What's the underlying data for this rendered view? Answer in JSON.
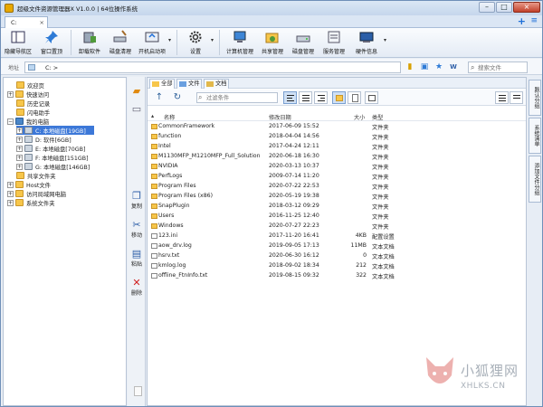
{
  "window": {
    "title": "超级文件资源管理器X V1.0.0 | 64位操作系统",
    "active_tab": "C:",
    "tab_close": "×",
    "min": "–",
    "max": "□",
    "close": "×"
  },
  "toolbar": {
    "items": [
      {
        "label": "隐藏导航区",
        "icon": "sidebar-icon"
      },
      {
        "label": "窗口置顶",
        "icon": "pin-icon"
      },
      {
        "label": "卸载软件",
        "icon": "uninstall-icon"
      },
      {
        "label": "磁盘清理",
        "icon": "disk-clean-icon"
      },
      {
        "label": "开机启动项",
        "icon": "startup-icon"
      },
      {
        "label": "设置",
        "icon": "gear-icon"
      },
      {
        "label": "计算机管理",
        "icon": "computer-icon"
      },
      {
        "label": "共享管理",
        "icon": "share-icon"
      },
      {
        "label": "磁盘管理",
        "icon": "disk-icon"
      },
      {
        "label": "服务管理",
        "icon": "services-icon"
      },
      {
        "label": "硬件信息",
        "icon": "hardware-icon"
      }
    ]
  },
  "address": {
    "label": "地址",
    "path": "C: >",
    "search_placeholder": "搜索文件"
  },
  "tree": {
    "items": [
      {
        "label": "欢迎页"
      },
      {
        "label": "快速访问"
      },
      {
        "label": "历史记录"
      },
      {
        "label": "闪电助手"
      },
      {
        "label": "我的电脑"
      },
      {
        "label": "C: 本地磁盘[19GB]"
      },
      {
        "label": "D: 软件[6GB]"
      },
      {
        "label": "E: 本地磁盘[70GB]"
      },
      {
        "label": "F: 本地磁盘[151GB]"
      },
      {
        "label": "G: 本地磁盘[146GB]"
      },
      {
        "label": "共享文件夹"
      },
      {
        "label": "Host文件"
      },
      {
        "label": "访问局域网电脑"
      },
      {
        "label": "系统文件夹"
      }
    ]
  },
  "side_actions": {
    "copy": "复制",
    "move": "移动",
    "paste": "粘贴",
    "delete": "删除"
  },
  "file_tabs": [
    "全部",
    "文件",
    "文档"
  ],
  "filter_placeholder": "过滤条件",
  "columns": {
    "name": "名称",
    "modified": "修改日期",
    "size": "大小",
    "type": "类型"
  },
  "files": [
    {
      "name": "CommonFramework",
      "modified": "2017-06-09 15:52",
      "size": "",
      "type": "文件夹",
      "kind": "folder"
    },
    {
      "name": "function",
      "modified": "2018-04-04 14:56",
      "size": "",
      "type": "文件夹",
      "kind": "folder"
    },
    {
      "name": "Intel",
      "modified": "2017-04-24 12:11",
      "size": "",
      "type": "文件夹",
      "kind": "folder"
    },
    {
      "name": "M1130MFP_M1210MFP_Full_Solution",
      "modified": "2020-06-18 16:30",
      "size": "",
      "type": "文件夹",
      "kind": "folder"
    },
    {
      "name": "NVIDIA",
      "modified": "2020-03-13 10:37",
      "size": "",
      "type": "文件夹",
      "kind": "folder"
    },
    {
      "name": "PerfLogs",
      "modified": "2009-07-14 11:20",
      "size": "",
      "type": "文件夹",
      "kind": "folder"
    },
    {
      "name": "Program Files",
      "modified": "2020-07-22 22:53",
      "size": "",
      "type": "文件夹",
      "kind": "folder"
    },
    {
      "name": "Program Files (x86)",
      "modified": "2020-05-19 19:38",
      "size": "",
      "type": "文件夹",
      "kind": "folder"
    },
    {
      "name": "SnapPlugin",
      "modified": "2018-03-12 09:29",
      "size": "",
      "type": "文件夹",
      "kind": "folder"
    },
    {
      "name": "Users",
      "modified": "2016-11-25 12:40",
      "size": "",
      "type": "文件夹",
      "kind": "folder"
    },
    {
      "name": "Windows",
      "modified": "2020-07-27 22:23",
      "size": "",
      "type": "文件夹",
      "kind": "folder"
    },
    {
      "name": "123.ini",
      "modified": "2017-11-20 16:41",
      "size": "4KB",
      "type": "配置设置",
      "kind": "file"
    },
    {
      "name": "aow_drv.log",
      "modified": "2019-09-05 17:13",
      "size": "11MB",
      "type": "文本文档",
      "kind": "file"
    },
    {
      "name": "hsrv.txt",
      "modified": "2020-06-30 16:12",
      "size": "0",
      "type": "文本文档",
      "kind": "file"
    },
    {
      "name": "kmlog.log",
      "modified": "2018-09-02 18:34",
      "size": "212",
      "type": "文本文档",
      "kind": "file"
    },
    {
      "name": "offline_FtnInfo.txt",
      "modified": "2019-08-15 09:32",
      "size": "322",
      "type": "文本文档",
      "kind": "file"
    }
  ],
  "right_tabs": [
    "默认分组",
    "系统清单",
    "添加文件分组"
  ],
  "watermark": {
    "name": "小狐狸网",
    "url": "XHLKS.CN"
  },
  "colors": {
    "selection": "#3c78d8",
    "folder": "#f7c64a",
    "accent": "#1e6fd8"
  }
}
